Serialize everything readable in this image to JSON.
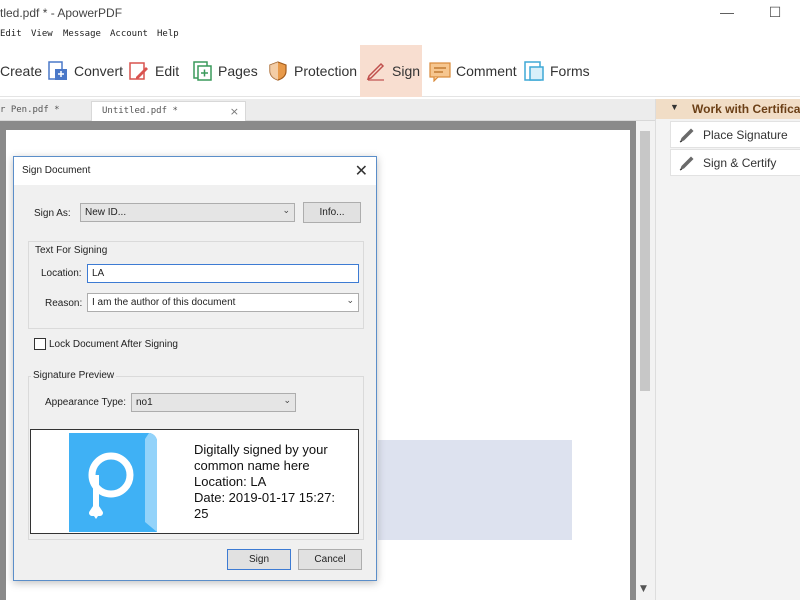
{
  "window": {
    "title": "tled.pdf * - ApowerPDF",
    "minimize": "—",
    "maximize": "☐"
  },
  "menu": [
    "Edit",
    "View",
    "Message",
    "Account",
    "Help"
  ],
  "toolbar": {
    "create": "Create",
    "convert": "Convert",
    "edit": "Edit",
    "pages": "Pages",
    "protection": "Protection",
    "sign": "Sign",
    "comment": "Comment",
    "forms": "Forms"
  },
  "tabs": {
    "tab1": "r Pen.pdf *",
    "tab2": "Untitled.pdf *",
    "close": "×"
  },
  "right_panel": {
    "header": "Work with Certificates",
    "items": [
      "Place Signature",
      "Sign & Certify"
    ]
  },
  "dialog": {
    "title": "Sign Document",
    "close": "✕",
    "sign_as_label": "Sign As:",
    "sign_as_value": "New ID...",
    "info_button": "Info...",
    "text_for_signing": "Text For Signing",
    "location_label": "Location:",
    "location_value": "LA",
    "reason_label": "Reason:",
    "reason_value": "I am the author of this document",
    "lock_label": "Lock Document After Signing",
    "lock_checked": false,
    "signature_preview": "Signature Preview",
    "appearance_label": "Appearance Type:",
    "appearance_value": "no1",
    "preview_lines": [
      "Digitally signed by your",
      "common name here",
      "Location: LA",
      "Date: 2019-01-17 15:27:",
      "25"
    ],
    "sign_button": "Sign",
    "cancel_button": "Cancel"
  },
  "colors": {
    "sign_active_bg": "#f8ded0",
    "dialog_border": "#5b8ec9",
    "logo_blue": "#3fb1f5",
    "panel_header_bg": "#f1ddc6",
    "signature_field": "#dde2ef"
  },
  "icons": {
    "create": "document-icon",
    "convert": "convert-icon",
    "edit": "edit-pen-icon",
    "pages": "pages-icon",
    "protection": "shield-icon",
    "sign": "signature-pen-icon",
    "comment": "comment-icon",
    "forms": "forms-icon",
    "panel_items": "pen-icon",
    "logo": "apowerpdf-logo"
  }
}
